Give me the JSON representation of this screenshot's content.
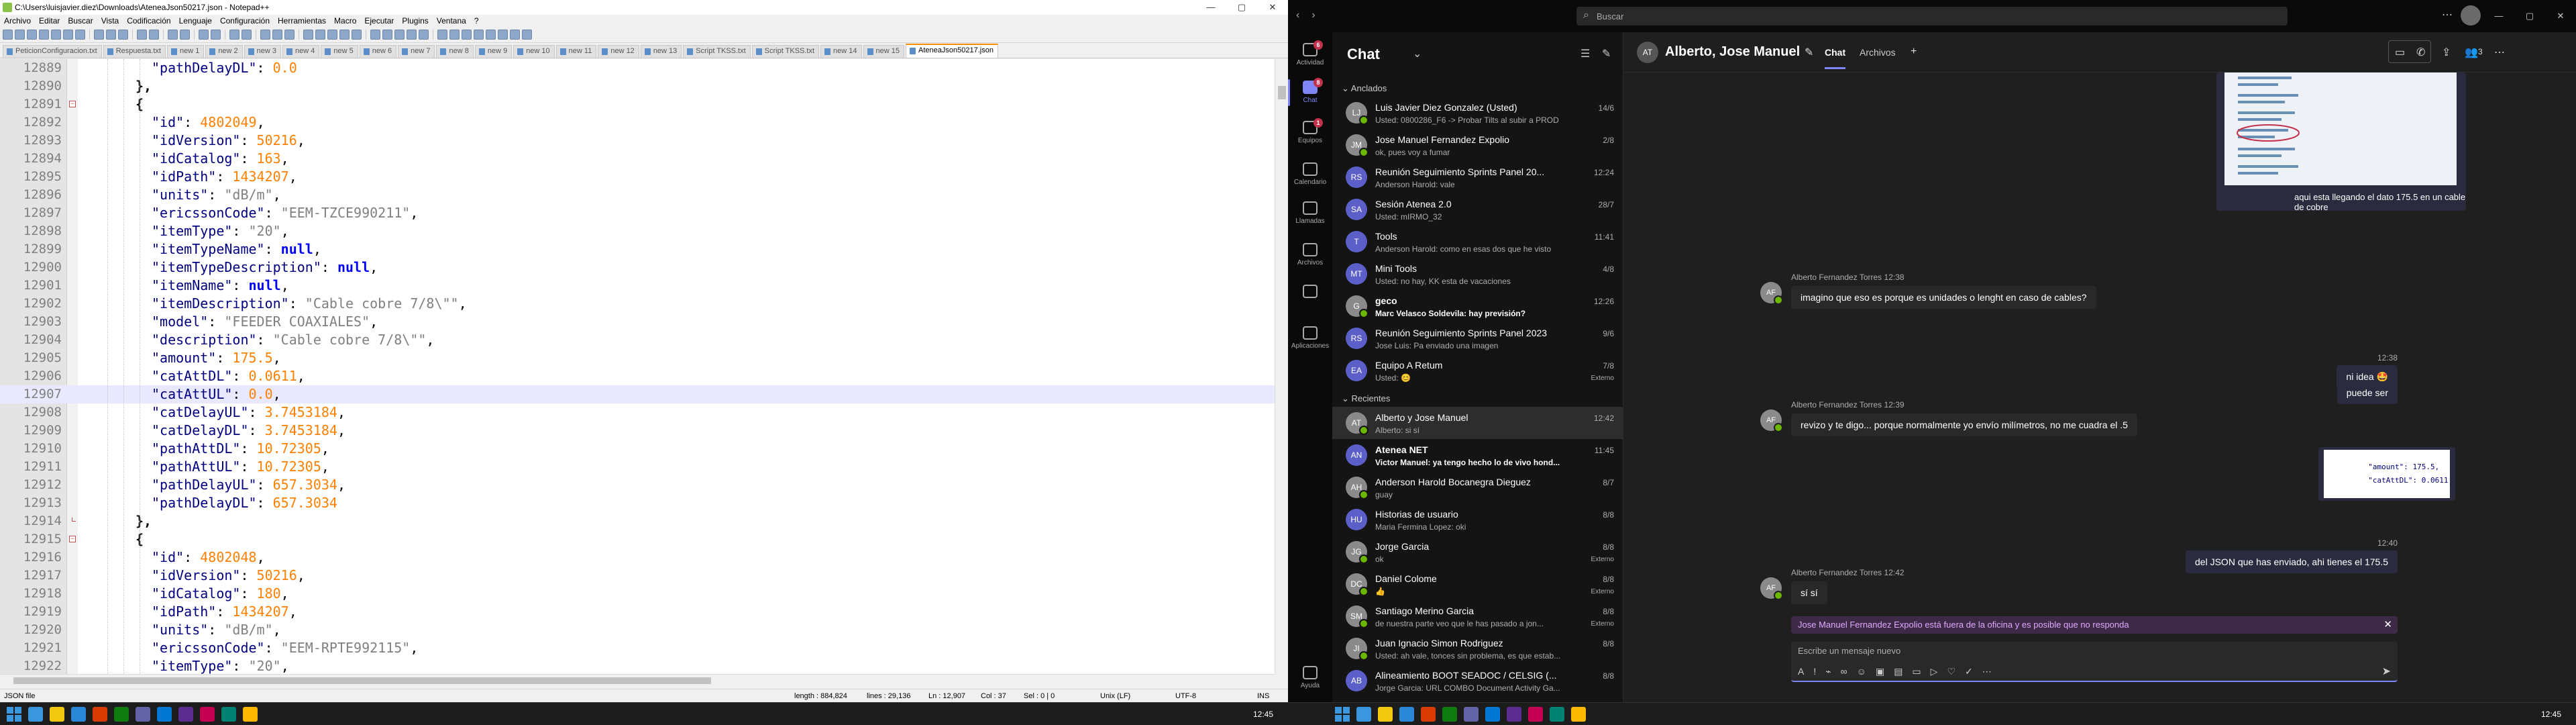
{
  "notepad": {
    "title": "C:\\Users\\luisjavier.diez\\Downloads\\AteneaJson50217.json - Notepad++",
    "menu": [
      "Archivo",
      "Editar",
      "Buscar",
      "Vista",
      "Codificación",
      "Lenguaje",
      "Configuración",
      "Herramientas",
      "Macro",
      "Ejecutar",
      "Plugins",
      "Ventana",
      "?"
    ],
    "tabs": [
      "PeticionConfiguracion.txt",
      "Respuesta.txt",
      "new 1",
      "new 2",
      "new 3",
      "new 4",
      "new 5",
      "new 6",
      "new 7",
      "new 8",
      "new 9",
      "new 10",
      "new 11",
      "new 12",
      "new 13",
      "Script TKSS.txt",
      "Script TKSS.txt",
      "new 14",
      "new 15",
      "AteneaJson50217.json"
    ],
    "active_tab_index": 19,
    "lines": [
      {
        "n": "12889",
        "indent": 4,
        "tokens": [
          [
            "k",
            "\"pathDelayDL\""
          ],
          [
            "p",
            ": "
          ],
          [
            "n",
            "0.0"
          ]
        ]
      },
      {
        "n": "12890",
        "indent": 3,
        "tokens": [
          [
            "brace",
            "},"
          ]
        ]
      },
      {
        "n": "12891",
        "indent": 3,
        "fold": "open",
        "tokens": [
          [
            "brace",
            "{"
          ]
        ]
      },
      {
        "n": "12892",
        "indent": 4,
        "tokens": [
          [
            "k",
            "\"id\""
          ],
          [
            "p",
            ": "
          ],
          [
            "n",
            "4802049"
          ],
          [
            "p",
            ","
          ]
        ]
      },
      {
        "n": "12893",
        "indent": 4,
        "tokens": [
          [
            "k",
            "\"idVersion\""
          ],
          [
            "p",
            ": "
          ],
          [
            "n",
            "50216"
          ],
          [
            "p",
            ","
          ]
        ]
      },
      {
        "n": "12894",
        "indent": 4,
        "tokens": [
          [
            "k",
            "\"idCatalog\""
          ],
          [
            "p",
            ": "
          ],
          [
            "n",
            "163"
          ],
          [
            "p",
            ","
          ]
        ]
      },
      {
        "n": "12895",
        "indent": 4,
        "tokens": [
          [
            "k",
            "\"idPath\""
          ],
          [
            "p",
            ": "
          ],
          [
            "n",
            "1434207"
          ],
          [
            "p",
            ","
          ]
        ]
      },
      {
        "n": "12896",
        "indent": 4,
        "tokens": [
          [
            "k",
            "\"units\""
          ],
          [
            "p",
            ": "
          ],
          [
            "s",
            "\"dB/m\""
          ],
          [
            "p",
            ","
          ]
        ]
      },
      {
        "n": "12897",
        "indent": 4,
        "tokens": [
          [
            "k",
            "\"ericssonCode\""
          ],
          [
            "p",
            ": "
          ],
          [
            "s",
            "\"EEM-TZCE990211\""
          ],
          [
            "p",
            ","
          ]
        ]
      },
      {
        "n": "12898",
        "indent": 4,
        "tokens": [
          [
            "k",
            "\"itemType\""
          ],
          [
            "p",
            ": "
          ],
          [
            "s",
            "\"20\""
          ],
          [
            "p",
            ","
          ]
        ]
      },
      {
        "n": "12899",
        "indent": 4,
        "tokens": [
          [
            "k",
            "\"itemTypeName\""
          ],
          [
            "p",
            ": "
          ],
          [
            "kw",
            "null"
          ],
          [
            "p",
            ","
          ]
        ]
      },
      {
        "n": "12900",
        "indent": 4,
        "tokens": [
          [
            "k",
            "\"itemTypeDescription\""
          ],
          [
            "p",
            ": "
          ],
          [
            "kw",
            "null"
          ],
          [
            "p",
            ","
          ]
        ]
      },
      {
        "n": "12901",
        "indent": 4,
        "tokens": [
          [
            "k",
            "\"itemName\""
          ],
          [
            "p",
            ": "
          ],
          [
            "kw",
            "null"
          ],
          [
            "p",
            ","
          ]
        ]
      },
      {
        "n": "12902",
        "indent": 4,
        "tokens": [
          [
            "k",
            "\"itemDescription\""
          ],
          [
            "p",
            ": "
          ],
          [
            "s",
            "\"Cable cobre 7/8\\\"\""
          ],
          [
            "p",
            ","
          ]
        ]
      },
      {
        "n": "12903",
        "indent": 4,
        "tokens": [
          [
            "k",
            "\"model\""
          ],
          [
            "p",
            ": "
          ],
          [
            "s",
            "\"FEEDER COAXIALES\""
          ],
          [
            "p",
            ","
          ]
        ]
      },
      {
        "n": "12904",
        "indent": 4,
        "tokens": [
          [
            "k",
            "\"description\""
          ],
          [
            "p",
            ": "
          ],
          [
            "s",
            "\"Cable cobre 7/8\\\"\""
          ],
          [
            "p",
            ","
          ]
        ]
      },
      {
        "n": "12905",
        "indent": 4,
        "tokens": [
          [
            "k",
            "\"amount\""
          ],
          [
            "p",
            ": "
          ],
          [
            "n",
            "175.5"
          ],
          [
            "p",
            ","
          ]
        ]
      },
      {
        "n": "12906",
        "indent": 4,
        "tokens": [
          [
            "k",
            "\"catAttDL\""
          ],
          [
            "p",
            ": "
          ],
          [
            "n",
            "0.0611"
          ],
          [
            "p",
            ","
          ]
        ]
      },
      {
        "n": "12907",
        "indent": 4,
        "current": true,
        "tokens": [
          [
            "k",
            "\"catAttUL\""
          ],
          [
            "p",
            ": "
          ],
          [
            "n",
            "0.0"
          ],
          [
            "p",
            ","
          ]
        ]
      },
      {
        "n": "12908",
        "indent": 4,
        "tokens": [
          [
            "k",
            "\"catDelayUL\""
          ],
          [
            "p",
            ": "
          ],
          [
            "n",
            "3.7453184"
          ],
          [
            "p",
            ","
          ]
        ]
      },
      {
        "n": "12909",
        "indent": 4,
        "tokens": [
          [
            "k",
            "\"catDelayDL\""
          ],
          [
            "p",
            ": "
          ],
          [
            "n",
            "3.7453184"
          ],
          [
            "p",
            ","
          ]
        ]
      },
      {
        "n": "12910",
        "indent": 4,
        "tokens": [
          [
            "k",
            "\"pathAttDL\""
          ],
          [
            "p",
            ": "
          ],
          [
            "n",
            "10.72305"
          ],
          [
            "p",
            ","
          ]
        ]
      },
      {
        "n": "12911",
        "indent": 4,
        "tokens": [
          [
            "k",
            "\"pathAttUL\""
          ],
          [
            "p",
            ": "
          ],
          [
            "n",
            "10.72305"
          ],
          [
            "p",
            ","
          ]
        ]
      },
      {
        "n": "12912",
        "indent": 4,
        "tokens": [
          [
            "k",
            "\"pathDelayUL\""
          ],
          [
            "p",
            ": "
          ],
          [
            "n",
            "657.3034"
          ],
          [
            "p",
            ","
          ]
        ]
      },
      {
        "n": "12913",
        "indent": 4,
        "tokens": [
          [
            "k",
            "\"pathDelayDL\""
          ],
          [
            "p",
            ": "
          ],
          [
            "n",
            "657.3034"
          ]
        ]
      },
      {
        "n": "12914",
        "indent": 3,
        "fold": "end",
        "tokens": [
          [
            "brace",
            "},"
          ]
        ]
      },
      {
        "n": "12915",
        "indent": 3,
        "fold": "open",
        "tokens": [
          [
            "brace",
            "{"
          ]
        ]
      },
      {
        "n": "12916",
        "indent": 4,
        "tokens": [
          [
            "k",
            "\"id\""
          ],
          [
            "p",
            ": "
          ],
          [
            "n",
            "4802048"
          ],
          [
            "p",
            ","
          ]
        ]
      },
      {
        "n": "12917",
        "indent": 4,
        "tokens": [
          [
            "k",
            "\"idVersion\""
          ],
          [
            "p",
            ": "
          ],
          [
            "n",
            "50216"
          ],
          [
            "p",
            ","
          ]
        ]
      },
      {
        "n": "12918",
        "indent": 4,
        "tokens": [
          [
            "k",
            "\"idCatalog\""
          ],
          [
            "p",
            ": "
          ],
          [
            "n",
            "180"
          ],
          [
            "p",
            ","
          ]
        ]
      },
      {
        "n": "12919",
        "indent": 4,
        "tokens": [
          [
            "k",
            "\"idPath\""
          ],
          [
            "p",
            ": "
          ],
          [
            "n",
            "1434207"
          ],
          [
            "p",
            ","
          ]
        ]
      },
      {
        "n": "12920",
        "indent": 4,
        "tokens": [
          [
            "k",
            "\"units\""
          ],
          [
            "p",
            ": "
          ],
          [
            "s",
            "\"dB/m\""
          ],
          [
            "p",
            ","
          ]
        ]
      },
      {
        "n": "12921",
        "indent": 4,
        "tokens": [
          [
            "k",
            "\"ericssonCode\""
          ],
          [
            "p",
            ": "
          ],
          [
            "s",
            "\"EEM-RPTE992115\""
          ],
          [
            "p",
            ","
          ]
        ]
      },
      {
        "n": "12922",
        "indent": 4,
        "tokens": [
          [
            "k",
            "\"itemType\""
          ],
          [
            "p",
            ": "
          ],
          [
            "s",
            "\"20\""
          ],
          [
            "p",
            ","
          ]
        ]
      }
    ],
    "status": {
      "lang": "JSON file",
      "length": "length : 884,824",
      "lines": "lines : 29,136",
      "ln": "Ln : 12,907",
      "col": "Col : 37",
      "sel": "Sel : 0 | 0",
      "eol": "Unix (LF)",
      "enc": "UTF-8",
      "ins": "INS"
    }
  },
  "teams": {
    "search_placeholder": "Buscar",
    "rail": [
      {
        "label": "Actividad",
        "badge": "6"
      },
      {
        "label": "Chat",
        "badge": "8",
        "active": true
      },
      {
        "label": "Equipos",
        "badge": "1"
      },
      {
        "label": "Calendario",
        "badge": ""
      },
      {
        "label": "Llamadas",
        "badge": ""
      },
      {
        "label": "Archivos",
        "badge": ""
      },
      {
        "label": "",
        "badge": ""
      },
      {
        "label": "Aplicaciones",
        "badge": ""
      },
      {
        "label": "Ayuda",
        "badge": ""
      }
    ],
    "chat_title": "Chat",
    "section_pinned": "Anclados",
    "section_recent": "Recientes",
    "pinned": [
      {
        "name": "Luis Javier Diez Gonzalez (Usted)",
        "preview": "Usted: 0800286_F6 -> Probar Tilts al subir a PROD",
        "date": "14/6",
        "ext": "",
        "avatar": "LJ",
        "person": true
      },
      {
        "name": "Jose Manuel Fernandez Expolio",
        "preview": "ok, pues voy a fumar",
        "date": "2/8",
        "ext": "",
        "avatar": "JM",
        "person": true
      },
      {
        "name": "Reunión Seguimiento Sprints Panel 20...",
        "preview": "Anderson Harold: vale",
        "date": "12:24",
        "ext": "",
        "avatar": "RS",
        "person": false
      },
      {
        "name": "Sesión Atenea 2.0",
        "preview": "Usted: mIRMO_32",
        "date": "28/7",
        "ext": "",
        "avatar": "SA",
        "person": false
      },
      {
        "name": "Tools",
        "preview": "Anderson Harold: como en esas dos que he visto",
        "date": "11:41",
        "ext": "",
        "avatar": "T",
        "person": false
      },
      {
        "name": "Mini Tools",
        "preview": "Usted: no hay, KK esta de vacaciones",
        "date": "4/8",
        "ext": "",
        "avatar": "MT",
        "person": false
      },
      {
        "name": "geco",
        "preview": "Marc Velasco Soldevila: hay previsión?",
        "date": "12:26",
        "ext": "",
        "avatar": "G",
        "person": true,
        "unread": true
      },
      {
        "name": "Reunión Seguimiento Sprints Panel 2023",
        "preview": "Jose Luis: Pa enviado una imagen",
        "date": "9/6",
        "ext": "",
        "avatar": "RS",
        "person": false
      },
      {
        "name": "Equipo A Retum",
        "preview": "Usted: 😊",
        "date": "7/8",
        "ext": "Externo",
        "avatar": "EA",
        "person": false
      }
    ],
    "recent": [
      {
        "name": "Alberto y Jose Manuel",
        "preview": "Alberto: si sí",
        "date": "12:42",
        "ext": "",
        "avatar": "AT",
        "person": true,
        "selected": true
      },
      {
        "name": "Atenea NET",
        "preview": "Victor Manuel: ya tengo hecho lo de vivo hond...",
        "date": "11:45",
        "ext": "",
        "avatar": "AN",
        "person": false,
        "unread": true
      },
      {
        "name": "Anderson Harold Bocanegra Dieguez",
        "preview": "guay",
        "date": "8/7",
        "ext": "",
        "avatar": "AH",
        "person": true
      },
      {
        "name": "Historias de usuario",
        "preview": "Maria Fermina Lopez: oki",
        "date": "8/8",
        "ext": "",
        "avatar": "HU",
        "person": false
      },
      {
        "name": "Jorge Garcia",
        "preview": "ok",
        "date": "8/8",
        "ext": "Externo",
        "avatar": "JG",
        "person": true
      },
      {
        "name": "Daniel Colome",
        "preview": "👍",
        "date": "8/8",
        "ext": "Externo",
        "avatar": "DC",
        "person": true
      },
      {
        "name": "Santiago Merino Garcia",
        "preview": "de nuestra parte veo que le has pasado a jon...",
        "date": "8/8",
        "ext": "Externo",
        "avatar": "SM",
        "person": true
      },
      {
        "name": "Juan Ignacio Simon Rodriguez",
        "preview": "Usted: ah vale, tonces sin problema, es que estab...",
        "date": "8/8",
        "ext": "",
        "avatar": "JI",
        "person": true
      },
      {
        "name": "Alineamiento BOOT SEADOC / CELSIG (...",
        "preview": "Jorge Garcia: URL COMBO Document Activity Ga...",
        "date": "8/8",
        "ext": "",
        "avatar": "AB",
        "person": false
      }
    ],
    "conversation": {
      "avatar": "AT",
      "title": "Alberto, Jose Manuel",
      "tab_chat": "Chat",
      "tab_files": "Archivos",
      "header_count": "3",
      "image_caption": "aqui esta llegando el dato 175.5 en un cable de cobre",
      "messages": [
        {
          "dir": "in",
          "author": "Alberto Fernandez Torres",
          "time": "12:38",
          "text": "imagino que eso es porque es unidades o lenght en caso de cables?",
          "avatar": "AF"
        },
        {
          "dir": "out",
          "time": "12:38",
          "text": "ni idea 🤩"
        },
        {
          "dir": "out",
          "time": "",
          "text": "puede ser"
        },
        {
          "dir": "in",
          "author": "Alberto Fernandez Torres",
          "time": "12:39",
          "text": "revizo y te digo... porque normalmente yo envío milímetros, no me cuadra el .5",
          "avatar": "AF"
        },
        {
          "dir": "out",
          "time": "12:40",
          "text": "del JSON que has enviado, ahi tienes el 175.5"
        },
        {
          "dir": "in",
          "author": "Alberto Fernandez Torres",
          "time": "12:42",
          "text": "sí sí",
          "avatar": "AF"
        }
      ],
      "snippet_lines": [
        "\"amount\": 175.5,",
        "\"catAttDL\": 0.0611,"
      ],
      "oof_notice": "Jose Manuel Fernandez Expolio está fuera de la oficina y es posible que no responda",
      "compose_placeholder": "Escribe un mensaje nuevo"
    }
  },
  "taskbar": {
    "time_left": "12:45",
    "time_right": "12:45"
  }
}
